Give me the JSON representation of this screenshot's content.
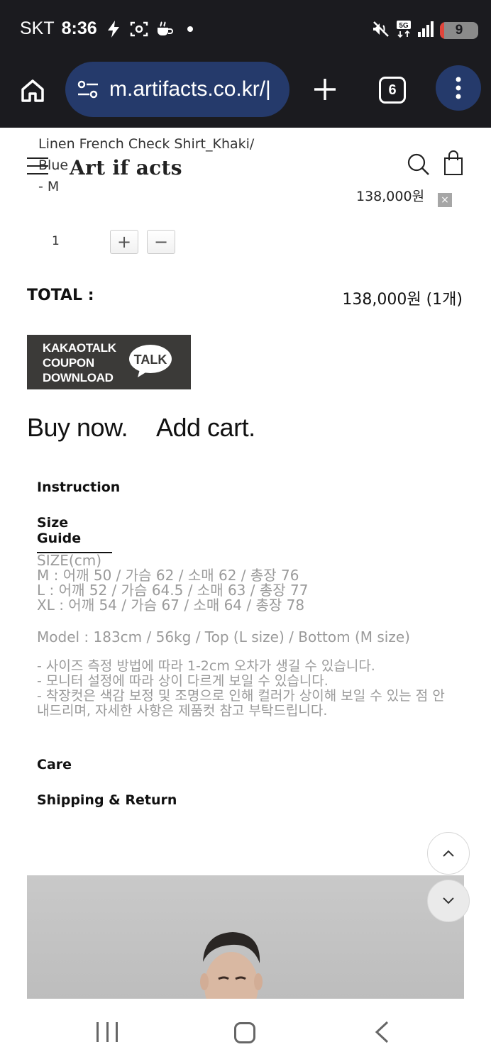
{
  "status_bar": {
    "carrier": "SKT",
    "time": "8:36",
    "battery_level": "9",
    "network": "5G"
  },
  "browser": {
    "url": "m.artifacts.co.kr/|",
    "tab_count": "6"
  },
  "header": {
    "logo": "Art if acts"
  },
  "product_option": {
    "name": "Linen French Check Shirt_Khaki/ Blue",
    "option": "- M",
    "price": "138,000원",
    "delete_glyph": "×",
    "quantity": "1",
    "plus": "+",
    "minus": "−"
  },
  "total": {
    "label": "TOTAL :",
    "value": "138,000원 (1개)"
  },
  "coupon": {
    "lines": [
      "KAKAOTALK",
      "COUPON",
      "DOWNLOAD"
    ],
    "bubble": "TALK"
  },
  "actions": {
    "buy_now": "Buy now.",
    "add_cart": "Add cart."
  },
  "tabs": {
    "instruction": "Instruction",
    "size_guide": "Size Guide",
    "care": "Care",
    "shipping": "Shipping & Return"
  },
  "size_guide": {
    "header": "SIZE(cm)",
    "rows": [
      "M : 어깨 50 / 가슴 62 / 소매 62 / 총장 76",
      "L : 어깨 52 / 가슴 64.5 / 소매 63 / 총장 77",
      "XL : 어깨 54 / 가슴 67 / 소매 64 / 총장 78"
    ],
    "model": "Model : 183cm / 56kg / Top (L size) / Bottom (M size)",
    "notes": [
      "- 사이즈 측정 방법에 따라 1-2cm 오차가 생길 수 있습니다.",
      "- 모니터 설정에 따라 상이 다르게 보일 수 있습니다.",
      "- 착장컷은 색감 보정 및 조명으로 인해 컬러가 상이해 보일 수 있는 점 안내드리며, 자세한 사항은 제품컷 참고 부탁드립니다."
    ]
  },
  "colors": {
    "system_bar": "#1b1b1f",
    "url_bar": "#253a6b",
    "battery_fill": "#e1453b",
    "muted_text": "#9a9a9a",
    "coupon_bg": "#3b3a38"
  },
  "icons": {
    "home": "home-icon",
    "site_settings": "tune-icon",
    "new_tab": "plus-icon",
    "menu": "more-vert-icon",
    "search": "search-icon",
    "bag": "shopping-bag-icon",
    "scroll_up": "chevron-up-icon",
    "scroll_down": "chevron-down-icon"
  }
}
